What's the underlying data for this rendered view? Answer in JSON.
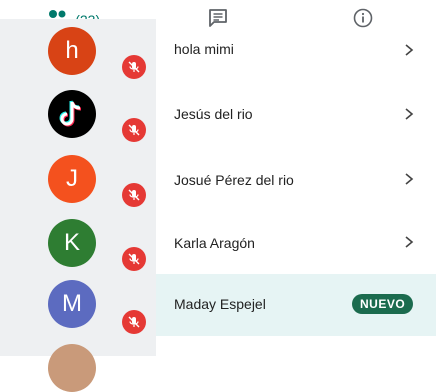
{
  "tabs": [
    {
      "label": "",
      "count": "(23)",
      "icon": "people-icon"
    },
    {
      "label": "",
      "icon": "chat-icon"
    },
    {
      "label": "",
      "icon": "info-icon"
    }
  ],
  "colors": {
    "accent": "#00796b",
    "mute_badge": "#e53935",
    "new_badge": "#1b6b4e",
    "left_panel": "#eef0f2",
    "highlight_row": "#e6f4f4"
  },
  "participants": [
    {
      "initial": "h",
      "name": "hola mimi",
      "avatar_color": "#d84315",
      "muted": true
    },
    {
      "initial": "",
      "name": "Jesús del rio",
      "avatar_color": "#000000",
      "muted": true,
      "avatar_icon": "tiktok-logo-icon"
    },
    {
      "initial": "J",
      "name": "Josué Pérez del rio",
      "avatar_color": "#f4511e",
      "muted": true
    },
    {
      "initial": "K",
      "name": "Karla Aragón",
      "avatar_color": "#2e7d32",
      "muted": true
    },
    {
      "initial": "M",
      "name": "Maday Espejel",
      "avatar_color": "#5c6bc0",
      "muted": true,
      "badge": "NUEVO"
    }
  ]
}
